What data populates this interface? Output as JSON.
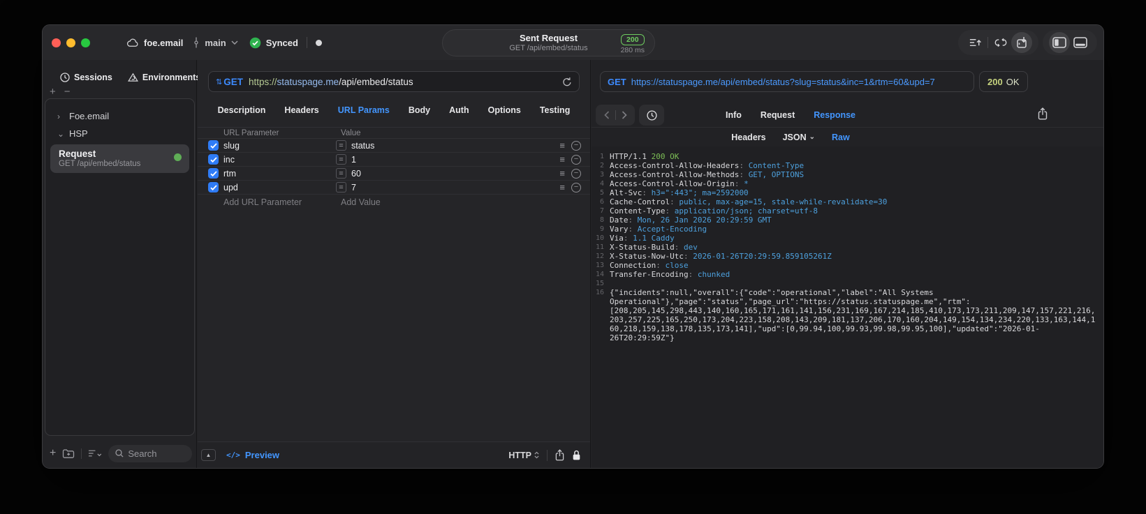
{
  "colors": {
    "accent": "#4396ff",
    "method_blue": "#3d8bff",
    "success_green": "#2fb34f",
    "badge_green": "#6ecb5f",
    "resp_green": "#7dbf56",
    "resp_blue": "#4da0dd",
    "olive": "#c6d37e"
  },
  "titlebar": {
    "project": "foe.email",
    "branch": "main",
    "sync_status": "Synced",
    "center": {
      "title": "Sent Request",
      "subtitle": "GET /api/embed/status",
      "status_code": "200",
      "duration": "280 ms"
    }
  },
  "sidebar": {
    "tabs": {
      "sessions": "Sessions",
      "environments": "Environments"
    },
    "tree": [
      {
        "label": "Foe.email",
        "expanded": false
      },
      {
        "label": "HSP",
        "expanded": true
      }
    ],
    "request_item": {
      "title": "Request",
      "subtitle": "GET /api/embed/status"
    },
    "search_placeholder": "Search"
  },
  "request_pane": {
    "method": "GET",
    "url_scheme": "https://",
    "url_host": "statuspage.me",
    "url_path": "/api/embed/status",
    "tabs": [
      "Description",
      "Headers",
      "URL Params",
      "Body",
      "Auth",
      "Options",
      "Testing"
    ],
    "active_tab": "URL Params",
    "table": {
      "col_name": "URL Parameter",
      "col_value": "Value",
      "rows": [
        {
          "name": "slug",
          "value": "status",
          "checked": true
        },
        {
          "name": "inc",
          "value": "1",
          "checked": true
        },
        {
          "name": "rtm",
          "value": "60",
          "checked": true
        },
        {
          "name": "upd",
          "value": "7",
          "checked": true
        }
      ],
      "add_name_placeholder": "Add URL Parameter",
      "add_value_placeholder": "Add Value"
    },
    "footer": {
      "preview_label": "Preview",
      "format_label": "HTTP"
    }
  },
  "response_pane": {
    "method": "GET",
    "url": "https://statuspage.me/api/embed/status?slug=status&inc=1&rtm=60&upd=7",
    "status_code": "200",
    "status_text": "OK",
    "tabs": [
      "Info",
      "Request",
      "Response"
    ],
    "active_tab": "Response",
    "subtabs": [
      {
        "label": "Headers",
        "has_menu": false
      },
      {
        "label": "JSON",
        "has_menu": true
      },
      {
        "label": "Raw",
        "has_menu": false
      }
    ],
    "active_subtab": "Raw",
    "status_line": {
      "protocol": "HTTP/1.1",
      "status": "200 OK"
    },
    "headers": [
      {
        "name": "Access-Control-Allow-Headers",
        "value": "Content-Type"
      },
      {
        "name": "Access-Control-Allow-Methods",
        "value": "GET, OPTIONS"
      },
      {
        "name": "Access-Control-Allow-Origin",
        "value": "*"
      },
      {
        "name": "Alt-Svc",
        "value": "h3=\":443\"; ma=2592000"
      },
      {
        "name": "Cache-Control",
        "value": "public, max-age=15, stale-while-revalidate=30"
      },
      {
        "name": "Content-Type",
        "value": "application/json; charset=utf-8"
      },
      {
        "name": "Date",
        "value": "Mon, 26 Jan 2026 20:29:59 GMT"
      },
      {
        "name": "Vary",
        "value": "Accept-Encoding"
      },
      {
        "name": "Via",
        "value": "1.1 Caddy"
      },
      {
        "name": "X-Status-Build",
        "value": "dev"
      },
      {
        "name": "X-Status-Now-Utc",
        "value": "2026-01-26T20:29:59.859105261Z"
      },
      {
        "name": "Connection",
        "value": "close"
      },
      {
        "name": "Transfer-Encoding",
        "value": "chunked"
      }
    ],
    "body": "{\"incidents\":null,\"overall\":{\"code\":\"operational\",\"label\":\"All Systems Operational\"},\"page\":\"status\",\"page_url\":\"https://status.statuspage.me\",\"rtm\":[208,205,145,298,443,140,160,165,171,161,141,156,231,169,167,214,185,410,173,173,211,209,147,157,221,216,203,257,225,165,250,173,204,223,158,208,143,209,181,137,206,170,160,204,149,154,134,234,220,133,163,144,160,218,159,138,178,135,173,141],\"upd\":[0,99.94,100,99.93,99.98,99.95,100],\"updated\":\"2026-01-26T20:29:59Z\"}"
  }
}
